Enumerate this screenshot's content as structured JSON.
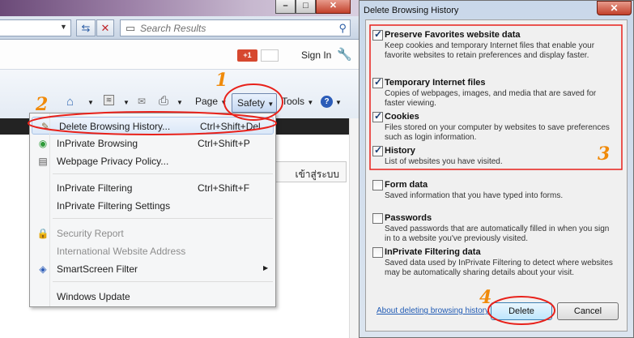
{
  "browser": {
    "window_controls": {
      "minimize": "–",
      "maximize": "□",
      "close": "✕"
    },
    "refresh_icon": "refresh-icon",
    "stop_icon": "stop-icon",
    "search": {
      "placeholder": "Search Results"
    },
    "google_plus": "+1",
    "sign_in": "Sign In",
    "command_bar": {
      "page_label": "Page",
      "safety_label": "Safety",
      "tools_label": "Tools",
      "help": "?"
    },
    "page_button": "เข้าสู่ระบบ"
  },
  "safety_menu": {
    "items": [
      {
        "label": "Delete Browsing History...",
        "shortcut": "Ctrl+Shift+Del",
        "icon": "delete-history-icon"
      },
      {
        "label": "InPrivate Browsing",
        "shortcut": "Ctrl+Shift+P",
        "icon": "inprivate-icon"
      },
      {
        "label": "Webpage Privacy Policy...",
        "shortcut": "",
        "icon": "privacy-policy-icon"
      },
      {
        "label": "InPrivate Filtering",
        "shortcut": "Ctrl+Shift+F"
      },
      {
        "label": "InPrivate Filtering Settings",
        "shortcut": ""
      },
      {
        "label": "Security Report",
        "shortcut": "",
        "icon": "lock-icon",
        "disabled": true
      },
      {
        "label": "International Website Address",
        "shortcut": "",
        "disabled": true
      },
      {
        "label": "SmartScreen Filter",
        "shortcut": "",
        "icon": "smartscreen-icon",
        "has_submenu": true
      },
      {
        "label": "Windows Update",
        "shortcut": ""
      }
    ]
  },
  "dialog": {
    "title": "Delete Browsing History",
    "close": "✕",
    "options": [
      {
        "title": "Preserve Favorites website data",
        "desc": "Keep cookies and temporary Internet files that enable your favorite websites to retain preferences and display faster.",
        "checked": true
      },
      {
        "title": "Temporary Internet files",
        "desc": "Copies of webpages, images, and media that are saved for faster viewing.",
        "checked": true
      },
      {
        "title": "Cookies",
        "desc": "Files stored on your computer by websites to save preferences such as login information.",
        "checked": true
      },
      {
        "title": "History",
        "desc": "List of websites you have visited.",
        "checked": true
      },
      {
        "title": "Form data",
        "desc": "Saved information that you have typed into forms.",
        "checked": false
      },
      {
        "title": "Passwords",
        "desc": "Saved passwords that are automatically filled in when you sign in to a website you've previously visited.",
        "checked": false
      },
      {
        "title": "InPrivate Filtering data",
        "desc": "Saved data used by InPrivate Filtering to detect where websites may be automatically sharing details about your visit.",
        "checked": false
      }
    ],
    "about_link": "About deleting browsing history",
    "delete_label": "Delete",
    "cancel_label": "Cancel"
  },
  "annotations": {
    "step1": "1",
    "step2": "2",
    "step3": "3",
    "step4": "4",
    "annotation_color": "#e8211a",
    "step_color": "#f08a0a"
  }
}
